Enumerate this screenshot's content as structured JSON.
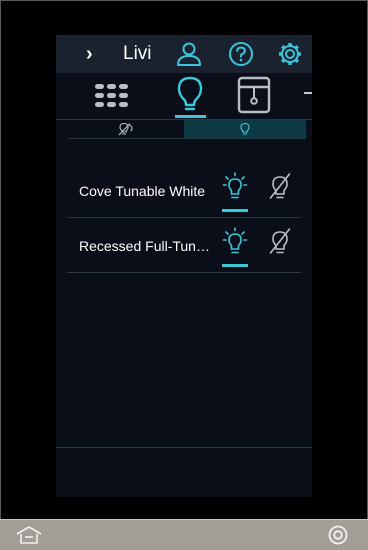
{
  "header": {
    "back_glyph": "›",
    "room_title": "Livi",
    "icons": [
      "user-icon",
      "help-icon",
      "settings-icon"
    ]
  },
  "tabs": [
    {
      "name": "keypad-tab",
      "icon": "keypad-icon",
      "selected": false
    },
    {
      "name": "lights-tab",
      "icon": "lightbulb-icon",
      "selected": true
    },
    {
      "name": "shades-tab",
      "icon": "shade-icon",
      "selected": false
    }
  ],
  "subfilter": {
    "all_icon": "all-lights-icon",
    "on_icon": "lights-on-icon",
    "selected": "on"
  },
  "lights": [
    {
      "label": "Cove Tunable White",
      "state": "on"
    },
    {
      "label": "Recessed Full-Tunable",
      "state": "on"
    }
  ],
  "colors": {
    "accent": "#3cc6da",
    "screen_bg": "#0a0e18",
    "header_bg": "#1a2230",
    "bezel_bar": "#a29d97"
  },
  "bottom_bar": {
    "home_icon": "home-icon",
    "power_icon": "power-icon"
  }
}
